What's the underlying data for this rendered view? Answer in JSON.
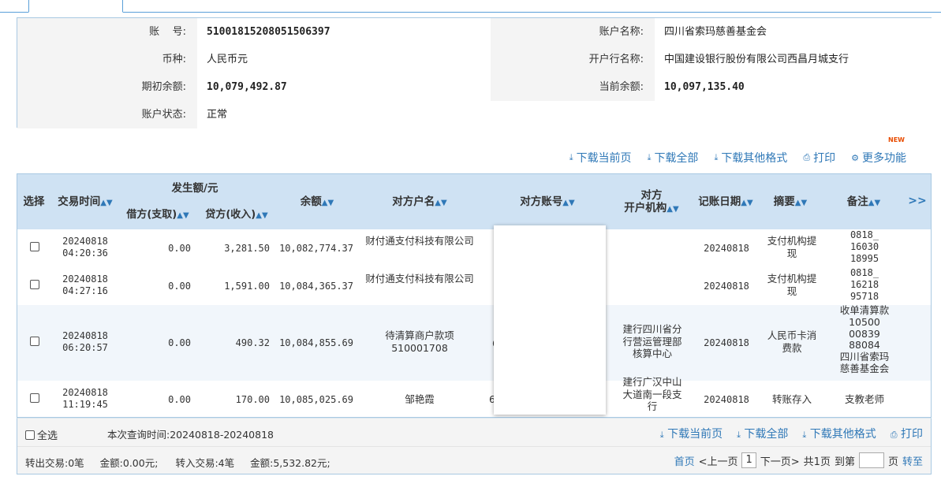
{
  "tab": {
    "label": ""
  },
  "account": {
    "account_no_label": "账    号:",
    "account_no": "510018152080515063​97",
    "account_name_label": "账户名称:",
    "account_name": "四川省索玛慈善基金会",
    "currency_label": "币种:",
    "currency": "人民币元",
    "bank_label": "开户行名称:",
    "bank": "中国建设银行股份有限公司西昌月城支行",
    "opening_balance_label": "期初余额:",
    "opening_balance": "10,079,492.87",
    "current_balance_label": "当前余额:",
    "current_balance": "10,097,135.40",
    "status_label": "账户状态:",
    "status": "正常"
  },
  "toolbar": {
    "download_page": "下载当前页",
    "download_all": "下载全部",
    "download_other": "下载其他格式",
    "print": "打印",
    "more": "更多功能",
    "new_badge": "NEW"
  },
  "table": {
    "headers": {
      "select": "选择",
      "time": "交易时间",
      "amount_group": "发生额/元",
      "debit": "借方(支取)",
      "credit": "贷方(收入)",
      "balance": "余额",
      "cp_name": "对方户名",
      "cp_account": "对方账号",
      "cp_bank_1": "对方",
      "cp_bank_2": "开户机构",
      "post_date": "记账日期",
      "summary": "摘要",
      "remark": "备注",
      "more": ">>"
    },
    "rows": [
      {
        "date": "20240818",
        "time": "04:20:36",
        "debit": "0.00",
        "credit": "3,281.50",
        "balance": "10,082,774.37",
        "cp_name": "财付通支付科技有限公司",
        "cp_account": "",
        "cp_bank": "",
        "post_date": "20240818",
        "summary": "支付机构提现",
        "remark": "0818_\n16030\n18995"
      },
      {
        "date": "20240818",
        "time": "04:27:16",
        "debit": "0.00",
        "credit": "1,591.00",
        "balance": "10,084,365.37",
        "cp_name": "财付通支付科技有限公司",
        "cp_account": "",
        "cp_bank": "",
        "post_date": "20240818",
        "summary": "支付机构提现",
        "remark": "0818_\n16218\n95718"
      },
      {
        "date": "20240818",
        "time": "06:20:57",
        "debit": "0.00",
        "credit": "490.32",
        "balance": "10,084,855.69",
        "cp_name": "待清算商户款项510001708",
        "cp_account": "6",
        "cp_bank": "建行四川省分行营运管理部核算中心",
        "post_date": "20240818",
        "summary": "人民币卡消费款",
        "remark": "收单清算款\n10500\n00839\n88084\n四川省索玛\n慈善基金会"
      },
      {
        "date": "20240818",
        "time": "11:19:45",
        "debit": "0.00",
        "credit": "170.00",
        "balance": "10,085,025.69",
        "cp_name": "邹艳霞",
        "cp_account": "6",
        "cp_bank": "建行广汉中山大道南一段支行",
        "post_date": "20240818",
        "summary": "转账存入",
        "remark": "支教老师"
      }
    ]
  },
  "footer": {
    "select_all": "全选",
    "query_time": "本次查询时间:20240818-20240818",
    "download_page": "下载当前页",
    "download_all": "下载全部",
    "download_other": "下载其他格式",
    "print": "打印",
    "out_count": "转出交易:0笔",
    "out_amount": "金额:0.00元;",
    "in_count": "转入交易:4笔",
    "in_amount": "金额:5,532.82元;",
    "first": "首页",
    "prev": "<上一页",
    "page": "1",
    "next": "下一页>",
    "total": "共1页",
    "goto_label": "到第",
    "page_unit": "页",
    "go": "转至"
  }
}
